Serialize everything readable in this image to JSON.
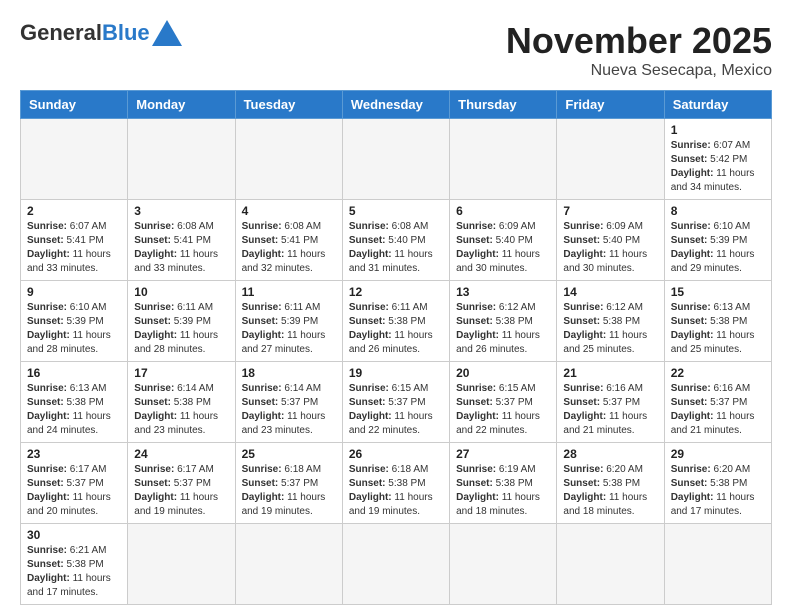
{
  "logo": {
    "text_general": "General",
    "text_blue": "Blue"
  },
  "header": {
    "month": "November 2025",
    "location": "Nueva Sesecapa, Mexico"
  },
  "weekdays": [
    "Sunday",
    "Monday",
    "Tuesday",
    "Wednesday",
    "Thursday",
    "Friday",
    "Saturday"
  ],
  "weeks": [
    [
      {
        "day": "",
        "info": ""
      },
      {
        "day": "",
        "info": ""
      },
      {
        "day": "",
        "info": ""
      },
      {
        "day": "",
        "info": ""
      },
      {
        "day": "",
        "info": ""
      },
      {
        "day": "",
        "info": ""
      },
      {
        "day": "1",
        "info": "Sunrise: 6:07 AM\nSunset: 5:42 PM\nDaylight: 11 hours and 34 minutes."
      }
    ],
    [
      {
        "day": "2",
        "info": "Sunrise: 6:07 AM\nSunset: 5:41 PM\nDaylight: 11 hours and 33 minutes."
      },
      {
        "day": "3",
        "info": "Sunrise: 6:08 AM\nSunset: 5:41 PM\nDaylight: 11 hours and 33 minutes."
      },
      {
        "day": "4",
        "info": "Sunrise: 6:08 AM\nSunset: 5:41 PM\nDaylight: 11 hours and 32 minutes."
      },
      {
        "day": "5",
        "info": "Sunrise: 6:08 AM\nSunset: 5:40 PM\nDaylight: 11 hours and 31 minutes."
      },
      {
        "day": "6",
        "info": "Sunrise: 6:09 AM\nSunset: 5:40 PM\nDaylight: 11 hours and 30 minutes."
      },
      {
        "day": "7",
        "info": "Sunrise: 6:09 AM\nSunset: 5:40 PM\nDaylight: 11 hours and 30 minutes."
      },
      {
        "day": "8",
        "info": "Sunrise: 6:10 AM\nSunset: 5:39 PM\nDaylight: 11 hours and 29 minutes."
      }
    ],
    [
      {
        "day": "9",
        "info": "Sunrise: 6:10 AM\nSunset: 5:39 PM\nDaylight: 11 hours and 28 minutes."
      },
      {
        "day": "10",
        "info": "Sunrise: 6:11 AM\nSunset: 5:39 PM\nDaylight: 11 hours and 28 minutes."
      },
      {
        "day": "11",
        "info": "Sunrise: 6:11 AM\nSunset: 5:39 PM\nDaylight: 11 hours and 27 minutes."
      },
      {
        "day": "12",
        "info": "Sunrise: 6:11 AM\nSunset: 5:38 PM\nDaylight: 11 hours and 26 minutes."
      },
      {
        "day": "13",
        "info": "Sunrise: 6:12 AM\nSunset: 5:38 PM\nDaylight: 11 hours and 26 minutes."
      },
      {
        "day": "14",
        "info": "Sunrise: 6:12 AM\nSunset: 5:38 PM\nDaylight: 11 hours and 25 minutes."
      },
      {
        "day": "15",
        "info": "Sunrise: 6:13 AM\nSunset: 5:38 PM\nDaylight: 11 hours and 25 minutes."
      }
    ],
    [
      {
        "day": "16",
        "info": "Sunrise: 6:13 AM\nSunset: 5:38 PM\nDaylight: 11 hours and 24 minutes."
      },
      {
        "day": "17",
        "info": "Sunrise: 6:14 AM\nSunset: 5:38 PM\nDaylight: 11 hours and 23 minutes."
      },
      {
        "day": "18",
        "info": "Sunrise: 6:14 AM\nSunset: 5:37 PM\nDaylight: 11 hours and 23 minutes."
      },
      {
        "day": "19",
        "info": "Sunrise: 6:15 AM\nSunset: 5:37 PM\nDaylight: 11 hours and 22 minutes."
      },
      {
        "day": "20",
        "info": "Sunrise: 6:15 AM\nSunset: 5:37 PM\nDaylight: 11 hours and 22 minutes."
      },
      {
        "day": "21",
        "info": "Sunrise: 6:16 AM\nSunset: 5:37 PM\nDaylight: 11 hours and 21 minutes."
      },
      {
        "day": "22",
        "info": "Sunrise: 6:16 AM\nSunset: 5:37 PM\nDaylight: 11 hours and 21 minutes."
      }
    ],
    [
      {
        "day": "23",
        "info": "Sunrise: 6:17 AM\nSunset: 5:37 PM\nDaylight: 11 hours and 20 minutes."
      },
      {
        "day": "24",
        "info": "Sunrise: 6:17 AM\nSunset: 5:37 PM\nDaylight: 11 hours and 19 minutes."
      },
      {
        "day": "25",
        "info": "Sunrise: 6:18 AM\nSunset: 5:37 PM\nDaylight: 11 hours and 19 minutes."
      },
      {
        "day": "26",
        "info": "Sunrise: 6:18 AM\nSunset: 5:38 PM\nDaylight: 11 hours and 19 minutes."
      },
      {
        "day": "27",
        "info": "Sunrise: 6:19 AM\nSunset: 5:38 PM\nDaylight: 11 hours and 18 minutes."
      },
      {
        "day": "28",
        "info": "Sunrise: 6:20 AM\nSunset: 5:38 PM\nDaylight: 11 hours and 18 minutes."
      },
      {
        "day": "29",
        "info": "Sunrise: 6:20 AM\nSunset: 5:38 PM\nDaylight: 11 hours and 17 minutes."
      }
    ],
    [
      {
        "day": "30",
        "info": "Sunrise: 6:21 AM\nSunset: 5:38 PM\nDaylight: 11 hours and 17 minutes."
      },
      {
        "day": "",
        "info": ""
      },
      {
        "day": "",
        "info": ""
      },
      {
        "day": "",
        "info": ""
      },
      {
        "day": "",
        "info": ""
      },
      {
        "day": "",
        "info": ""
      },
      {
        "day": "",
        "info": ""
      }
    ]
  ]
}
